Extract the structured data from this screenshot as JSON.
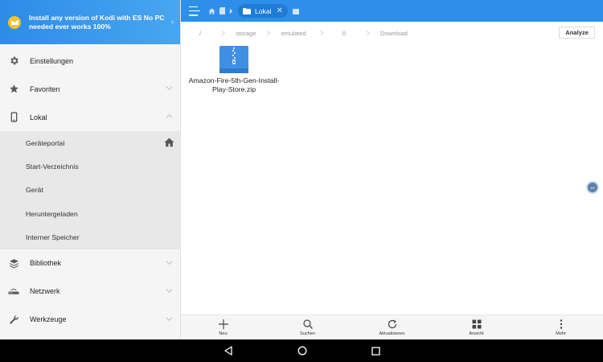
{
  "banner": {
    "line1": "Install any version of Kodi with ES No PC",
    "line2": "needed ever works 100%",
    "chevron": "›"
  },
  "sidebar": {
    "items": [
      {
        "label": "Einstellungen",
        "icon": "gear-icon"
      },
      {
        "label": "Favoriten",
        "icon": "star-icon",
        "arrow": "down"
      },
      {
        "label": "Lokal",
        "icon": "phone-icon",
        "arrow": "up"
      }
    ],
    "sub_items": [
      {
        "label": "Geräteportal"
      },
      {
        "label": "Start-Verzeichnis"
      },
      {
        "label": "Gerät"
      },
      {
        "label": "Heruntergeladen"
      },
      {
        "label": "Interner Speicher"
      }
    ],
    "items_after": [
      {
        "label": "Bibliothek",
        "icon": "library-icon",
        "arrow": "down"
      },
      {
        "label": "Netzwerk",
        "icon": "network-icon",
        "arrow": "down"
      },
      {
        "label": "Werkzeuge",
        "icon": "wrench-icon",
        "arrow": "down"
      }
    ]
  },
  "topbar": {
    "tab_label": "Lokal",
    "tab_close": "✕"
  },
  "breadcrumb": {
    "parts": [
      "/",
      "storage",
      "emulated",
      "0",
      "Download"
    ],
    "analyze_label": "Analyze"
  },
  "files": [
    {
      "name": "Amazon-Fire-5th-Gen-Install-Play-Store.zip",
      "type": "zip"
    }
  ],
  "toolbar": {
    "items": [
      {
        "label": "Neu",
        "icon": "plus-icon"
      },
      {
        "label": "Suchen",
        "icon": "search-icon"
      },
      {
        "label": "Aktualisieren",
        "icon": "refresh-icon"
      },
      {
        "label": "Ansicht",
        "icon": "grid-icon"
      },
      {
        "label": "Mehr",
        "icon": "more-icon"
      }
    ]
  },
  "floating": {
    "label": "ES"
  },
  "colors": {
    "accent": "#2d8fe9",
    "banner": "#49a6f0",
    "zip_blue": "#3f8fe3",
    "sidebar_bg": "#f5f5f5",
    "subnav_bg": "#e8e8e8"
  }
}
